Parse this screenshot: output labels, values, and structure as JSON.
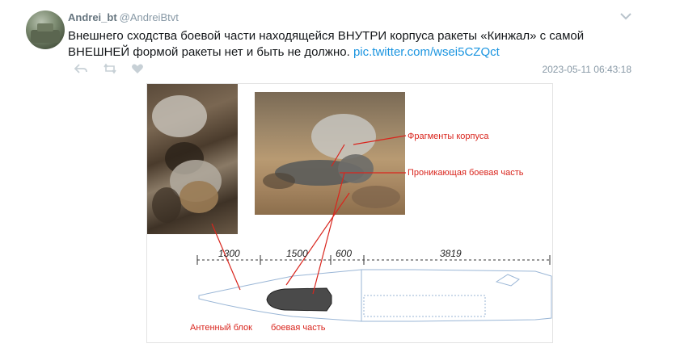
{
  "tweet": {
    "name": "Andrei_bt",
    "handle": "@AndreiBtvt",
    "text": "Внешнего сходства боевой части находящейся ВНУТРИ корпуса ракеты «Кинжал» с самой ВНЕШНЕЙ формой ракеты нет и быть не должно.",
    "link": "pic.twitter.com/wsei5CZQct",
    "timestamp": "2023-05-11 06:43:18"
  },
  "icons": {
    "chevron": "chevron-down-icon",
    "reply": "reply-icon",
    "retweet": "retweet-icon",
    "like": "heart-icon"
  },
  "media": {
    "labels": {
      "fragments": "Фрагменты корпуса",
      "penetrating": "Проникающая боевая часть",
      "antenna": "Антенный блок",
      "warhead": "боевая часть"
    },
    "dimensions": {
      "d1": "1300",
      "d2": "1500",
      "d3": "600",
      "d4": "3819"
    }
  },
  "colors": {
    "link": "#1b95e0",
    "annotation": "#d9251d",
    "meta": "#8899a6"
  }
}
